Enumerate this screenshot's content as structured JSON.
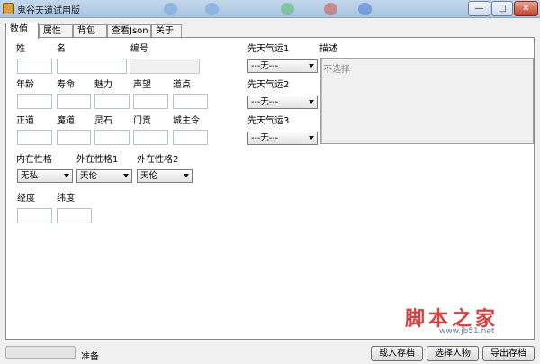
{
  "window": {
    "title": "鬼谷天道试用版",
    "minimize_label": "—",
    "maximize_label": "□",
    "close_label": "✕"
  },
  "tabs": [
    {
      "label": "数值",
      "active": true
    },
    {
      "label": "属性",
      "active": false
    },
    {
      "label": "背包",
      "active": false
    },
    {
      "label": "查看Json",
      "active": false
    },
    {
      "label": "关于",
      "active": false
    }
  ],
  "form": {
    "surname_label": "姓",
    "surname_value": "",
    "given_name_label": "名",
    "given_name_value": "",
    "id_label": "编号",
    "id_value": "",
    "age_label": "年龄",
    "age_value": "",
    "lifespan_label": "寿命",
    "lifespan_value": "",
    "charm_label": "魅力",
    "charm_value": "",
    "reputation_label": "声望",
    "reputation_value": "",
    "dao_points_label": "道点",
    "dao_points_value": "",
    "righteous_label": "正道",
    "righteous_value": "",
    "demonic_label": "魔道",
    "demonic_value": "",
    "spirit_stone_label": "灵石",
    "spirit_stone_value": "",
    "contribution_label": "门贡",
    "contribution_value": "",
    "city_lord_label": "城主令",
    "city_lord_value": "",
    "inner_trait_label": "内在性格",
    "inner_trait_value": "无私",
    "outer_trait1_label": "外在性格1",
    "outer_trait1_value": "天伦",
    "outer_trait2_label": "外在性格2",
    "outer_trait2_value": "天伦",
    "longitude_label": "经度",
    "longitude_value": "",
    "latitude_label": "纬度",
    "latitude_value": ""
  },
  "fortune": {
    "fortune1_label": "先天气运1",
    "fortune1_value": "---无---",
    "fortune2_label": "先天气运2",
    "fortune2_value": "---无---",
    "fortune3_label": "先天气运3",
    "fortune3_value": "---无---",
    "description_label": "描述",
    "description_text": "不选择"
  },
  "watermark": {
    "text": "脚本之家",
    "url": "www.jb51.net"
  },
  "statusbar": {
    "progress": 0,
    "status_text": "准备",
    "load_button": "载入存档",
    "select_button": "选择人物",
    "export_button": "导出存档"
  }
}
